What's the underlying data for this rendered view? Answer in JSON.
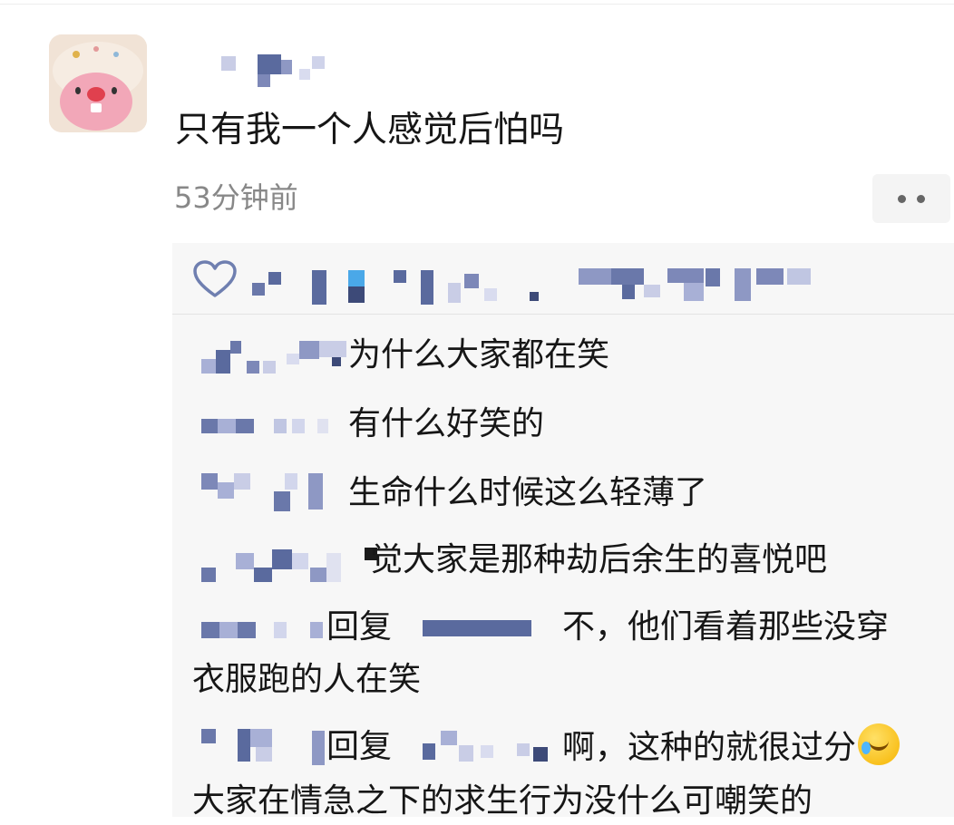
{
  "post": {
    "author": "",
    "text": "只有我一个人感觉后怕吗",
    "time": "53分钟前"
  },
  "icons": {
    "more": "more-dots-icon",
    "like": "heart-outline-icon",
    "emoji": "face-with-tears-of-joy-icon"
  },
  "colors": {
    "comment_bg": "#f7f7f7",
    "time_text": "#888888",
    "blur_dark": "#5a6a9e",
    "blur_light": "#c9cde6"
  },
  "comments": [
    {
      "text": "为什么大家都在笑"
    },
    {
      "text": "有什么好笑的"
    },
    {
      "text": "生命什么时候这么轻薄了"
    },
    {
      "text": "觉大家是那种劫后余生的喜悦吧"
    },
    {
      "reply_label": "回复",
      "text": "不，他们看着那些没穿",
      "text_cont": "衣服跑的人在笑"
    },
    {
      "reply_label": "回复",
      "text": "啊，这种的就很过分",
      "text_cont": "大家在情急之下的求生行为没什么可嘲笑的"
    }
  ]
}
